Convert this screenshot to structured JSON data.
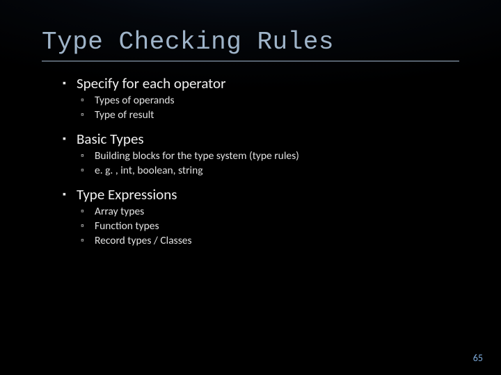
{
  "title": "Type Checking Rules",
  "items": [
    {
      "text": "Specify for each operator",
      "sub": [
        "Types of operands",
        "Type of result"
      ]
    },
    {
      "text": "Basic Types",
      "sub": [
        "Building blocks for the type system (type rules)",
        "e. g. , int, boolean, string"
      ]
    },
    {
      "text": "Type Expressions",
      "sub": [
        "Array types",
        "Function types",
        "Record types / Classes"
      ]
    }
  ],
  "page_number": "65"
}
